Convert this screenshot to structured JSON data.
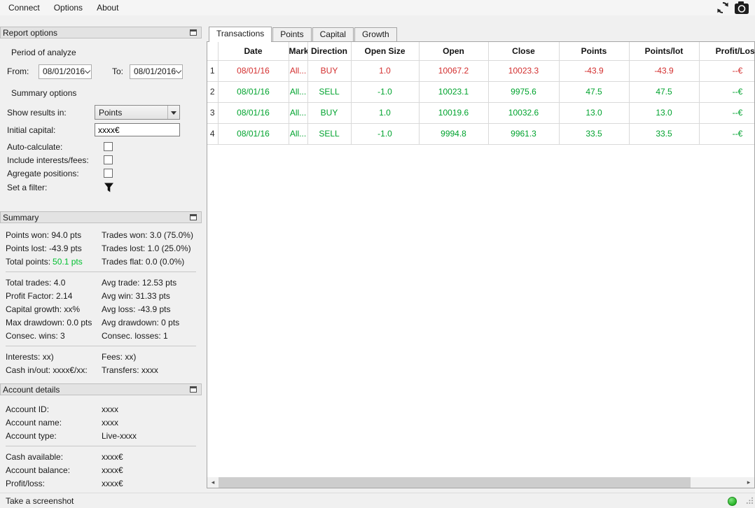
{
  "menubar": {
    "items": [
      "Connect",
      "Options",
      "About"
    ]
  },
  "toolbar": {
    "icons": [
      "refresh-icon",
      "screenshot-camera-icon"
    ]
  },
  "report_options": {
    "title": "Report options",
    "period_section_label": "Period of analyze",
    "from_label": "From:",
    "from_value": "08/01/2016",
    "to_label": "To:",
    "to_value": "08/01/2016",
    "summary_section_label": "Summary options",
    "show_results_label": "Show results in:",
    "show_results_value": "Points",
    "initial_capital_label": "Initial capital:",
    "initial_capital_value": "xxxx€",
    "checkboxes": [
      {
        "label": "Auto-calculate:",
        "state": "unchecked"
      },
      {
        "label": "Include interests/fees:",
        "state": "unchecked"
      },
      {
        "label": "Agregate positions:",
        "state": "unchecked"
      }
    ],
    "set_filter_label": "Set a filter:",
    "filter_icon": "funnel-icon"
  },
  "summary": {
    "title": "Summary",
    "rows_group1": [
      {
        "left": "Points won: 94.0 pts",
        "right": "Trades won: 3.0 (75.0%)"
      },
      {
        "left": "Points lost: -43.9 pts",
        "right": "Trades lost: 1.0 (25.0%)"
      },
      {
        "left_label": "Total points:",
        "left_value": "50.1 pts",
        "right": "Trades flat: 0.0 (0.0%)"
      }
    ],
    "rows_group2": [
      {
        "left": "Total trades: 4.0",
        "right": "Avg trade: 12.53 pts"
      },
      {
        "left": "Profit Factor: 2.14",
        "right": "Avg win: 31.33 pts"
      },
      {
        "left": "Capital growth: xx%",
        "right": "Avg loss: -43.9 pts"
      },
      {
        "left": "Max drawdown: 0.0 pts",
        "right": "Avg drawdown: 0 pts"
      },
      {
        "left": "Consec. wins: 3",
        "right": "Consec. losses: 1"
      }
    ],
    "rows_group3": [
      {
        "left": "Interests: xx)",
        "right": "Fees: xx)"
      },
      {
        "left": "Cash in/out: xxxx€/xx:",
        "right": "Transfers: xxxx"
      }
    ]
  },
  "account_details": {
    "title": "Account details",
    "rows_group1": [
      {
        "label": "Account ID:",
        "value": "xxxx"
      },
      {
        "label": "Account name:",
        "value": "xxxx"
      },
      {
        "label": "Account type:",
        "value": "Live-xxxx"
      }
    ],
    "rows_group2": [
      {
        "label": "Cash available:",
        "value": "xxxx€"
      },
      {
        "label": "Account balance:",
        "value": "xxxx€"
      },
      {
        "label": "Profit/loss:",
        "value": "xxxx€"
      }
    ]
  },
  "tabs": [
    {
      "label": "Transactions",
      "state": "active"
    },
    {
      "label": "Points",
      "state": "inactive"
    },
    {
      "label": "Capital",
      "state": "inactive"
    },
    {
      "label": "Growth",
      "state": "inactive"
    }
  ],
  "table": {
    "columns": [
      "Date",
      "Market",
      "Direction",
      "Open Size",
      "Open",
      "Close",
      "Points",
      "Points/lot",
      "Profit/Loss"
    ],
    "rows": [
      {
        "num": "1",
        "date": "08/01/16",
        "market": "All...",
        "direction": "BUY",
        "open_size": "1.0",
        "open": "10067.2",
        "close": "10023.3",
        "points": "-43.9",
        "points_lot": "-43.9",
        "profit_loss": "--€",
        "outcome": "loss"
      },
      {
        "num": "2",
        "date": "08/01/16",
        "market": "All...",
        "direction": "SELL",
        "open_size": "-1.0",
        "open": "10023.1",
        "close": "9975.6",
        "points": "47.5",
        "points_lot": "47.5",
        "profit_loss": "--€",
        "outcome": "win"
      },
      {
        "num": "3",
        "date": "08/01/16",
        "market": "All...",
        "direction": "BUY",
        "open_size": "1.0",
        "open": "10019.6",
        "close": "10032.6",
        "points": "13.0",
        "points_lot": "13.0",
        "profit_loss": "--€",
        "outcome": "win"
      },
      {
        "num": "4",
        "date": "08/01/16",
        "market": "All...",
        "direction": "SELL",
        "open_size": "-1.0",
        "open": "9994.8",
        "close": "9961.3",
        "points": "33.5",
        "points_lot": "33.5",
        "profit_loss": "--€",
        "outcome": "win"
      }
    ]
  },
  "statusbar": {
    "text": "Take a screenshot",
    "connection_state": "connected"
  },
  "colors": {
    "loss": "#d32f2f",
    "win": "#00a32e",
    "total-points": "#00c030",
    "status-dot": "#28b428"
  }
}
